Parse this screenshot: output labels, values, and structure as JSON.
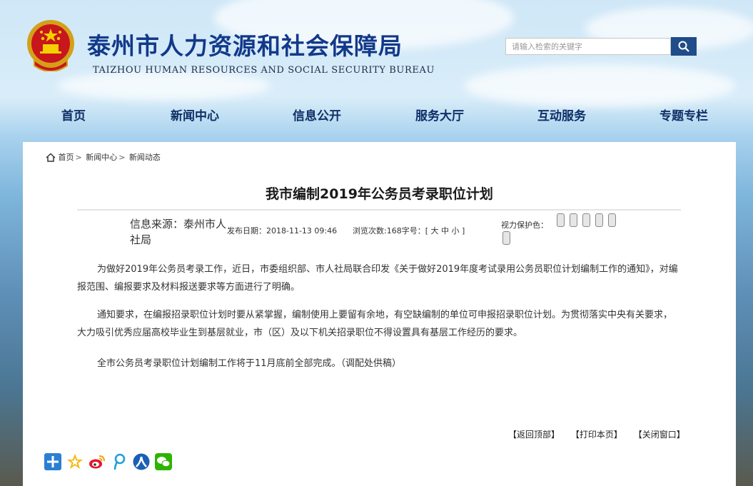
{
  "header": {
    "site_title": "泰州市人力资源和社会保障局",
    "site_subtitle": "TAIZHOU HUMAN RESOURCES AND SOCIAL SECURITY BUREAU",
    "search_placeholder": "请输入检索的关键字"
  },
  "nav": [
    "首页",
    "新闻中心",
    "信息公开",
    "服务大厅",
    "互动服务",
    "专题专栏"
  ],
  "breadcrumb": [
    "首页",
    "新闻中心",
    "新闻动态"
  ],
  "article": {
    "title": "我市编制2019年公务员考录职位计划",
    "source": "信息来源：泰州市人社局",
    "publish_date": "发布日期：2018-11-13 09:46",
    "views": "浏览次数:168",
    "font_size_label": "字号：[",
    "font_sizes": [
      "大",
      "中",
      "小"
    ],
    "font_size_close": "]",
    "eye_care_label": "视力保护色：",
    "paragraphs": [
      "为做好2019年公务员考录工作，近日，市委组织部、市人社局联合印发《关于做好2019年度考试录用公务员职位计划编制工作的通知》，对编报范围、编报要求及材料报送要求等方面进行了明确。",
      "通知要求，在编报招录职位计划时要从紧掌握，编制使用上要留有余地，有空缺编制的单位可申报招录职位计划。为贯彻落实中央有关要求，大力吸引优秀应届高校毕业生到基层就业，市（区）及以下机关招录职位不得设置具有基层工作经历的要求。",
      "全市公务员考录职位计划编制工作将于11月底前全部完成。（调配处供稿）"
    ],
    "actions": [
      "【返回顶部】",
      "【打印本页】",
      "【关闭窗口】"
    ]
  },
  "colors": {
    "brand": "#12398a",
    "nav_text": "#0f2f66",
    "search_button": "#1f4c8a"
  },
  "icons": {
    "search": "search-icon",
    "home": "home-icon",
    "emblem": "national-emblem-icon",
    "share": [
      "share-plus-icon",
      "favorite-star-icon",
      "weibo-icon",
      "tencent-weibo-icon",
      "renren-icon",
      "wechat-icon"
    ]
  }
}
